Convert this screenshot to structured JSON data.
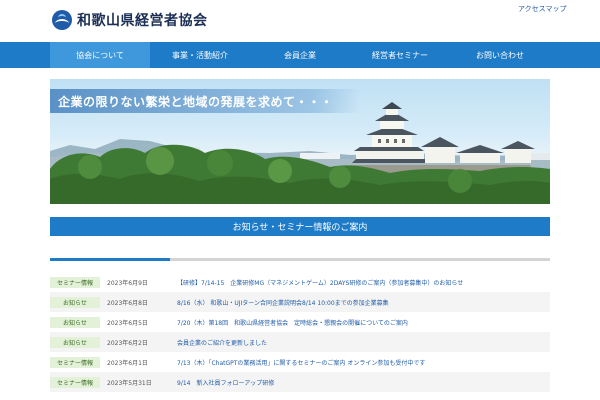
{
  "header": {
    "org_name": "和歌山県経営者協会",
    "access_link": "アクセスマップ"
  },
  "nav": {
    "items": [
      {
        "label": "協会について",
        "active": true
      },
      {
        "label": "事業・活動紹介",
        "active": false
      },
      {
        "label": "会員企業",
        "active": false
      },
      {
        "label": "経営者セミナー",
        "active": false
      },
      {
        "label": "お問い合わせ",
        "active": false
      }
    ]
  },
  "hero": {
    "caption": "企業の限りない繁栄と地域の発展を求めて・・・"
  },
  "news_section": {
    "title": "お知らせ・セミナー情報のご案内",
    "items": [
      {
        "category": "セミナー情報",
        "date": "2023年6月9日",
        "title": "【研修】7/14-15　企業研修MG（マネジメントゲーム）2DAYS研修のご案内（参加者募集中）のお知らせ"
      },
      {
        "category": "お知らせ",
        "date": "2023年6月8日",
        "title": "8/16（水） 和歌山・UJIターン合同企業説明会8/14 10:00までの参加企業募集"
      },
      {
        "category": "お知らせ",
        "date": "2023年6月5日",
        "title": "7/20（木）第18回　和歌山県経営者協会　定時総会・懇親会の開催についてのご案内"
      },
      {
        "category": "お知らせ",
        "date": "2023年6月2日",
        "title": "会員企業のご紹介を更新しました"
      },
      {
        "category": "セミナー情報",
        "date": "2023年6月1日",
        "title": "7/13（木）「ChatGPTの業務活用」に関するセミナーのご案内 オンライン参加も受付中です"
      },
      {
        "category": "セミナー情報",
        "date": "2023年5月31日",
        "title": "9/14　新入社員フォローアップ研修"
      }
    ]
  },
  "colors": {
    "brand_blue": "#1e7bc8",
    "nav_active": "#3f98dc",
    "category_bg": "#e3f1d8",
    "link_blue": "#1f5ba8"
  }
}
